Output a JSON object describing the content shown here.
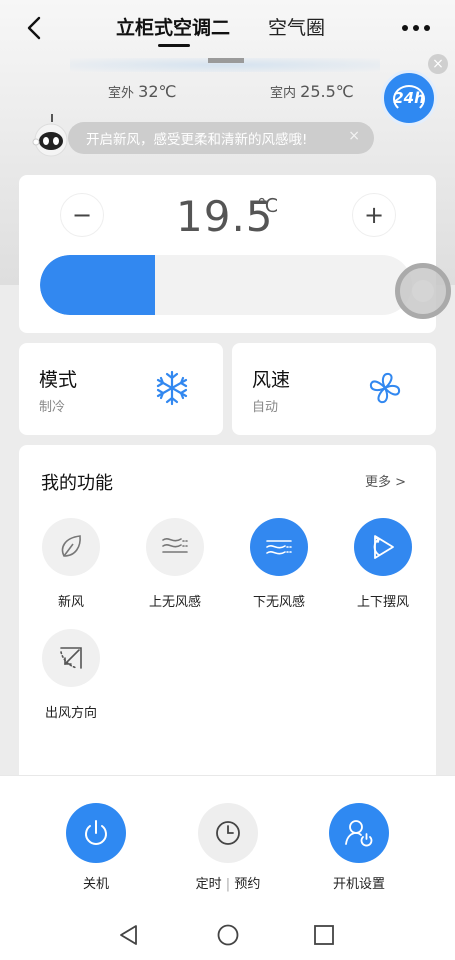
{
  "header": {
    "back_icon": "chevron-left-icon",
    "tab_ac": "立柜式空调二",
    "tab_air": "空气圈",
    "more_icon": "more-dots-icon"
  },
  "status": {
    "outdoor_label": "室外",
    "outdoor_value": "32℃",
    "indoor_label": "室内",
    "indoor_value": "25.5℃",
    "service_badge": "24h"
  },
  "notice": {
    "text": "开启新风，感受更柔和清新的风感哦!",
    "close": "×"
  },
  "temperature": {
    "minus": "−",
    "plus": "+",
    "value": "19.5",
    "unit": "℃",
    "slider_fraction": 0.31
  },
  "mode": {
    "title": "模式",
    "value": "制冷",
    "icon": "snowflake-icon"
  },
  "fan": {
    "title": "风速",
    "value": "自动",
    "icon": "fan-icon"
  },
  "functions": {
    "title": "我的功能",
    "more": "更多 >",
    "items": [
      {
        "label": "新风",
        "icon": "leaf-icon",
        "active": false
      },
      {
        "label": "上无风感",
        "icon": "wind-up-icon",
        "active": false
      },
      {
        "label": "下无风感",
        "icon": "wind-down-icon",
        "active": true
      },
      {
        "label": "上下摆风",
        "icon": "swing-icon",
        "active": true
      },
      {
        "label": "出风方向",
        "icon": "direction-icon",
        "active": false
      }
    ]
  },
  "actions": {
    "power": "关机",
    "timer_a": "定时",
    "timer_b": "预约",
    "settings": "开机设置"
  },
  "colors": {
    "accent": "#3288f0",
    "background": "#efefef",
    "card": "#ffffff"
  }
}
